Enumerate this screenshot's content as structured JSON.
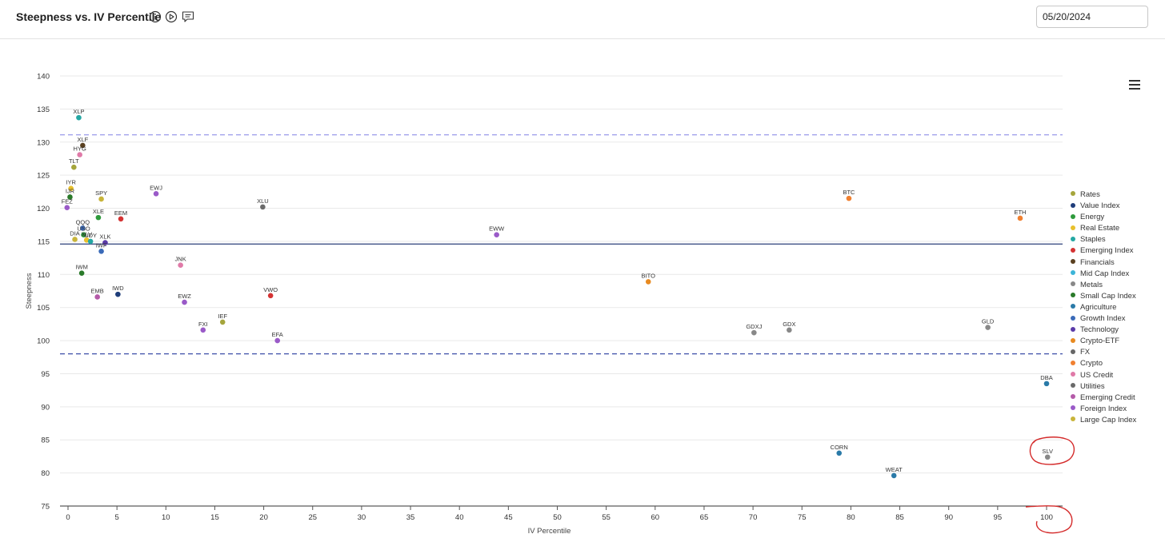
{
  "header": {
    "title": "Steepness vs. IV Percentile",
    "date_value": "05/20/2024",
    "icons": [
      "info-icon",
      "play-circle-icon",
      "comment-icon"
    ]
  },
  "menu": {
    "icon": "hamburger-menu-icon"
  },
  "chart_data": {
    "type": "scatter",
    "xlabel": "IV Percentile",
    "ylabel": "Steepness",
    "xlim": [
      0,
      100
    ],
    "ylim": [
      75,
      140
    ],
    "xticks": [
      0,
      5,
      10,
      15,
      20,
      25,
      30,
      35,
      40,
      45,
      50,
      55,
      60,
      65,
      70,
      75,
      80,
      85,
      90,
      95,
      100
    ],
    "yticks": [
      75,
      80,
      85,
      90,
      95,
      100,
      105,
      110,
      115,
      120,
      125,
      130,
      135,
      140
    ],
    "grid": "horizontal",
    "legend_position": "right",
    "reference_lines": [
      {
        "y": 131.1,
        "style": "dashed",
        "color": "#8f8fe8"
      },
      {
        "y": 114.6,
        "style": "solid",
        "color": "#2b3f7a"
      },
      {
        "y": 98.0,
        "style": "dashed",
        "color": "#3d4fa8"
      }
    ],
    "categories": [
      {
        "name": "Rates",
        "color": "#a5a53c"
      },
      {
        "name": "Value Index",
        "color": "#1f3d7a"
      },
      {
        "name": "Energy",
        "color": "#2e9a3c"
      },
      {
        "name": "Real Estate",
        "color": "#e8c02c"
      },
      {
        "name": "Staples",
        "color": "#24a7a3"
      },
      {
        "name": "Emerging Index",
        "color": "#d43333"
      },
      {
        "name": "Financials",
        "color": "#5a4020"
      },
      {
        "name": "Mid Cap Index",
        "color": "#3cb4d8"
      },
      {
        "name": "Metals",
        "color": "#888888"
      },
      {
        "name": "Small Cap Index",
        "color": "#2a7a2a"
      },
      {
        "name": "Agriculture",
        "color": "#2a7aa8"
      },
      {
        "name": "Growth Index",
        "color": "#3a6ab8"
      },
      {
        "name": "Technology",
        "color": "#5a3aa8"
      },
      {
        "name": "Crypto-ETF",
        "color": "#e88a20"
      },
      {
        "name": "FX",
        "color": "#666666"
      },
      {
        "name": "Crypto",
        "color": "#f08030"
      },
      {
        "name": "US Credit",
        "color": "#e07aa8"
      },
      {
        "name": "Utilities",
        "color": "#6a6a6a"
      },
      {
        "name": "Emerging Credit",
        "color": "#b45aa8"
      },
      {
        "name": "Foreign Index",
        "color": "#9a5ac8"
      },
      {
        "name": "Large Cap Index",
        "color": "#c8b43a"
      }
    ],
    "points": [
      {
        "label": "XLP",
        "x": 1.1,
        "y": 133.7,
        "category": "Staples"
      },
      {
        "label": "XLF",
        "x": 1.5,
        "y": 129.5,
        "category": "Financials"
      },
      {
        "label": "HYG",
        "x": 1.2,
        "y": 128.1,
        "category": "US Credit"
      },
      {
        "label": "TLT",
        "x": 0.6,
        "y": 126.2,
        "category": "Rates"
      },
      {
        "label": "IYR",
        "x": 0.3,
        "y": 123.0,
        "category": "Real Estate"
      },
      {
        "label": "IJR",
        "x": 0.2,
        "y": 121.7,
        "category": "Small Cap Index"
      },
      {
        "label": "FEZ",
        "x": -0.1,
        "y": 120.1,
        "category": "Foreign Index"
      },
      {
        "label": "SPY",
        "x": 3.4,
        "y": 121.4,
        "category": "Large Cap Index"
      },
      {
        "label": "EWJ",
        "x": 9.0,
        "y": 122.2,
        "category": "Foreign Index"
      },
      {
        "label": "XLU",
        "x": 19.9,
        "y": 120.2,
        "category": "Utilities"
      },
      {
        "label": "XLE",
        "x": 3.1,
        "y": 118.6,
        "category": "Energy"
      },
      {
        "label": "EEM",
        "x": 5.4,
        "y": 118.4,
        "category": "Emerging Index"
      },
      {
        "label": "QQQ",
        "x": 1.5,
        "y": 117.0,
        "category": "Growth Index"
      },
      {
        "label": "USO",
        "x": 1.6,
        "y": 116.0,
        "category": "Energy"
      },
      {
        "label": "DIA",
        "x": 0.7,
        "y": 115.3,
        "category": "Large Cap Index"
      },
      {
        "label": "XLV",
        "x": 1.9,
        "y": 115.2,
        "category": "Real Estate"
      },
      {
        "label": "UDY",
        "x": 2.3,
        "y": 115.0,
        "category": "Staples"
      },
      {
        "label": "XLK",
        "x": 3.8,
        "y": 114.8,
        "category": "Technology"
      },
      {
        "label": "IWF",
        "x": 3.4,
        "y": 113.5,
        "category": "Growth Index"
      },
      {
        "label": "IWM",
        "x": 1.4,
        "y": 110.2,
        "category": "Small Cap Index"
      },
      {
        "label": "JNK",
        "x": 11.5,
        "y": 111.4,
        "category": "US Credit"
      },
      {
        "label": "EMB",
        "x": 3.0,
        "y": 106.6,
        "category": "Emerging Credit"
      },
      {
        "label": "IWD",
        "x": 5.1,
        "y": 107.0,
        "category": "Value Index"
      },
      {
        "label": "EWZ",
        "x": 11.9,
        "y": 105.8,
        "category": "Foreign Index"
      },
      {
        "label": "VWO",
        "x": 20.7,
        "y": 106.8,
        "category": "Emerging Index"
      },
      {
        "label": "FXI",
        "x": 13.8,
        "y": 101.6,
        "category": "Foreign Index"
      },
      {
        "label": "IEF",
        "x": 15.8,
        "y": 102.8,
        "category": "Rates"
      },
      {
        "label": "EFA",
        "x": 21.4,
        "y": 100.0,
        "category": "Foreign Index"
      },
      {
        "label": "EWW",
        "x": 43.8,
        "y": 116.0,
        "category": "Foreign Index"
      },
      {
        "label": "BITO",
        "x": 59.3,
        "y": 108.9,
        "category": "Crypto-ETF"
      },
      {
        "label": "BTC",
        "x": 79.8,
        "y": 121.5,
        "category": "Crypto"
      },
      {
        "label": "ETH",
        "x": 97.3,
        "y": 118.5,
        "category": "Crypto"
      },
      {
        "label": "GDXJ",
        "x": 70.1,
        "y": 101.2,
        "category": "Metals"
      },
      {
        "label": "GDX",
        "x": 73.7,
        "y": 101.6,
        "category": "Metals"
      },
      {
        "label": "GLD",
        "x": 94.0,
        "y": 102.0,
        "category": "Metals"
      },
      {
        "label": "DBA",
        "x": 100.0,
        "y": 93.5,
        "category": "Agriculture"
      },
      {
        "label": "SLV",
        "x": 100.1,
        "y": 82.4,
        "category": "Metals"
      },
      {
        "label": "CORN",
        "x": 78.8,
        "y": 83.0,
        "category": "Agriculture"
      },
      {
        "label": "WEAT",
        "x": 84.4,
        "y": 79.6,
        "category": "Agriculture"
      }
    ]
  }
}
